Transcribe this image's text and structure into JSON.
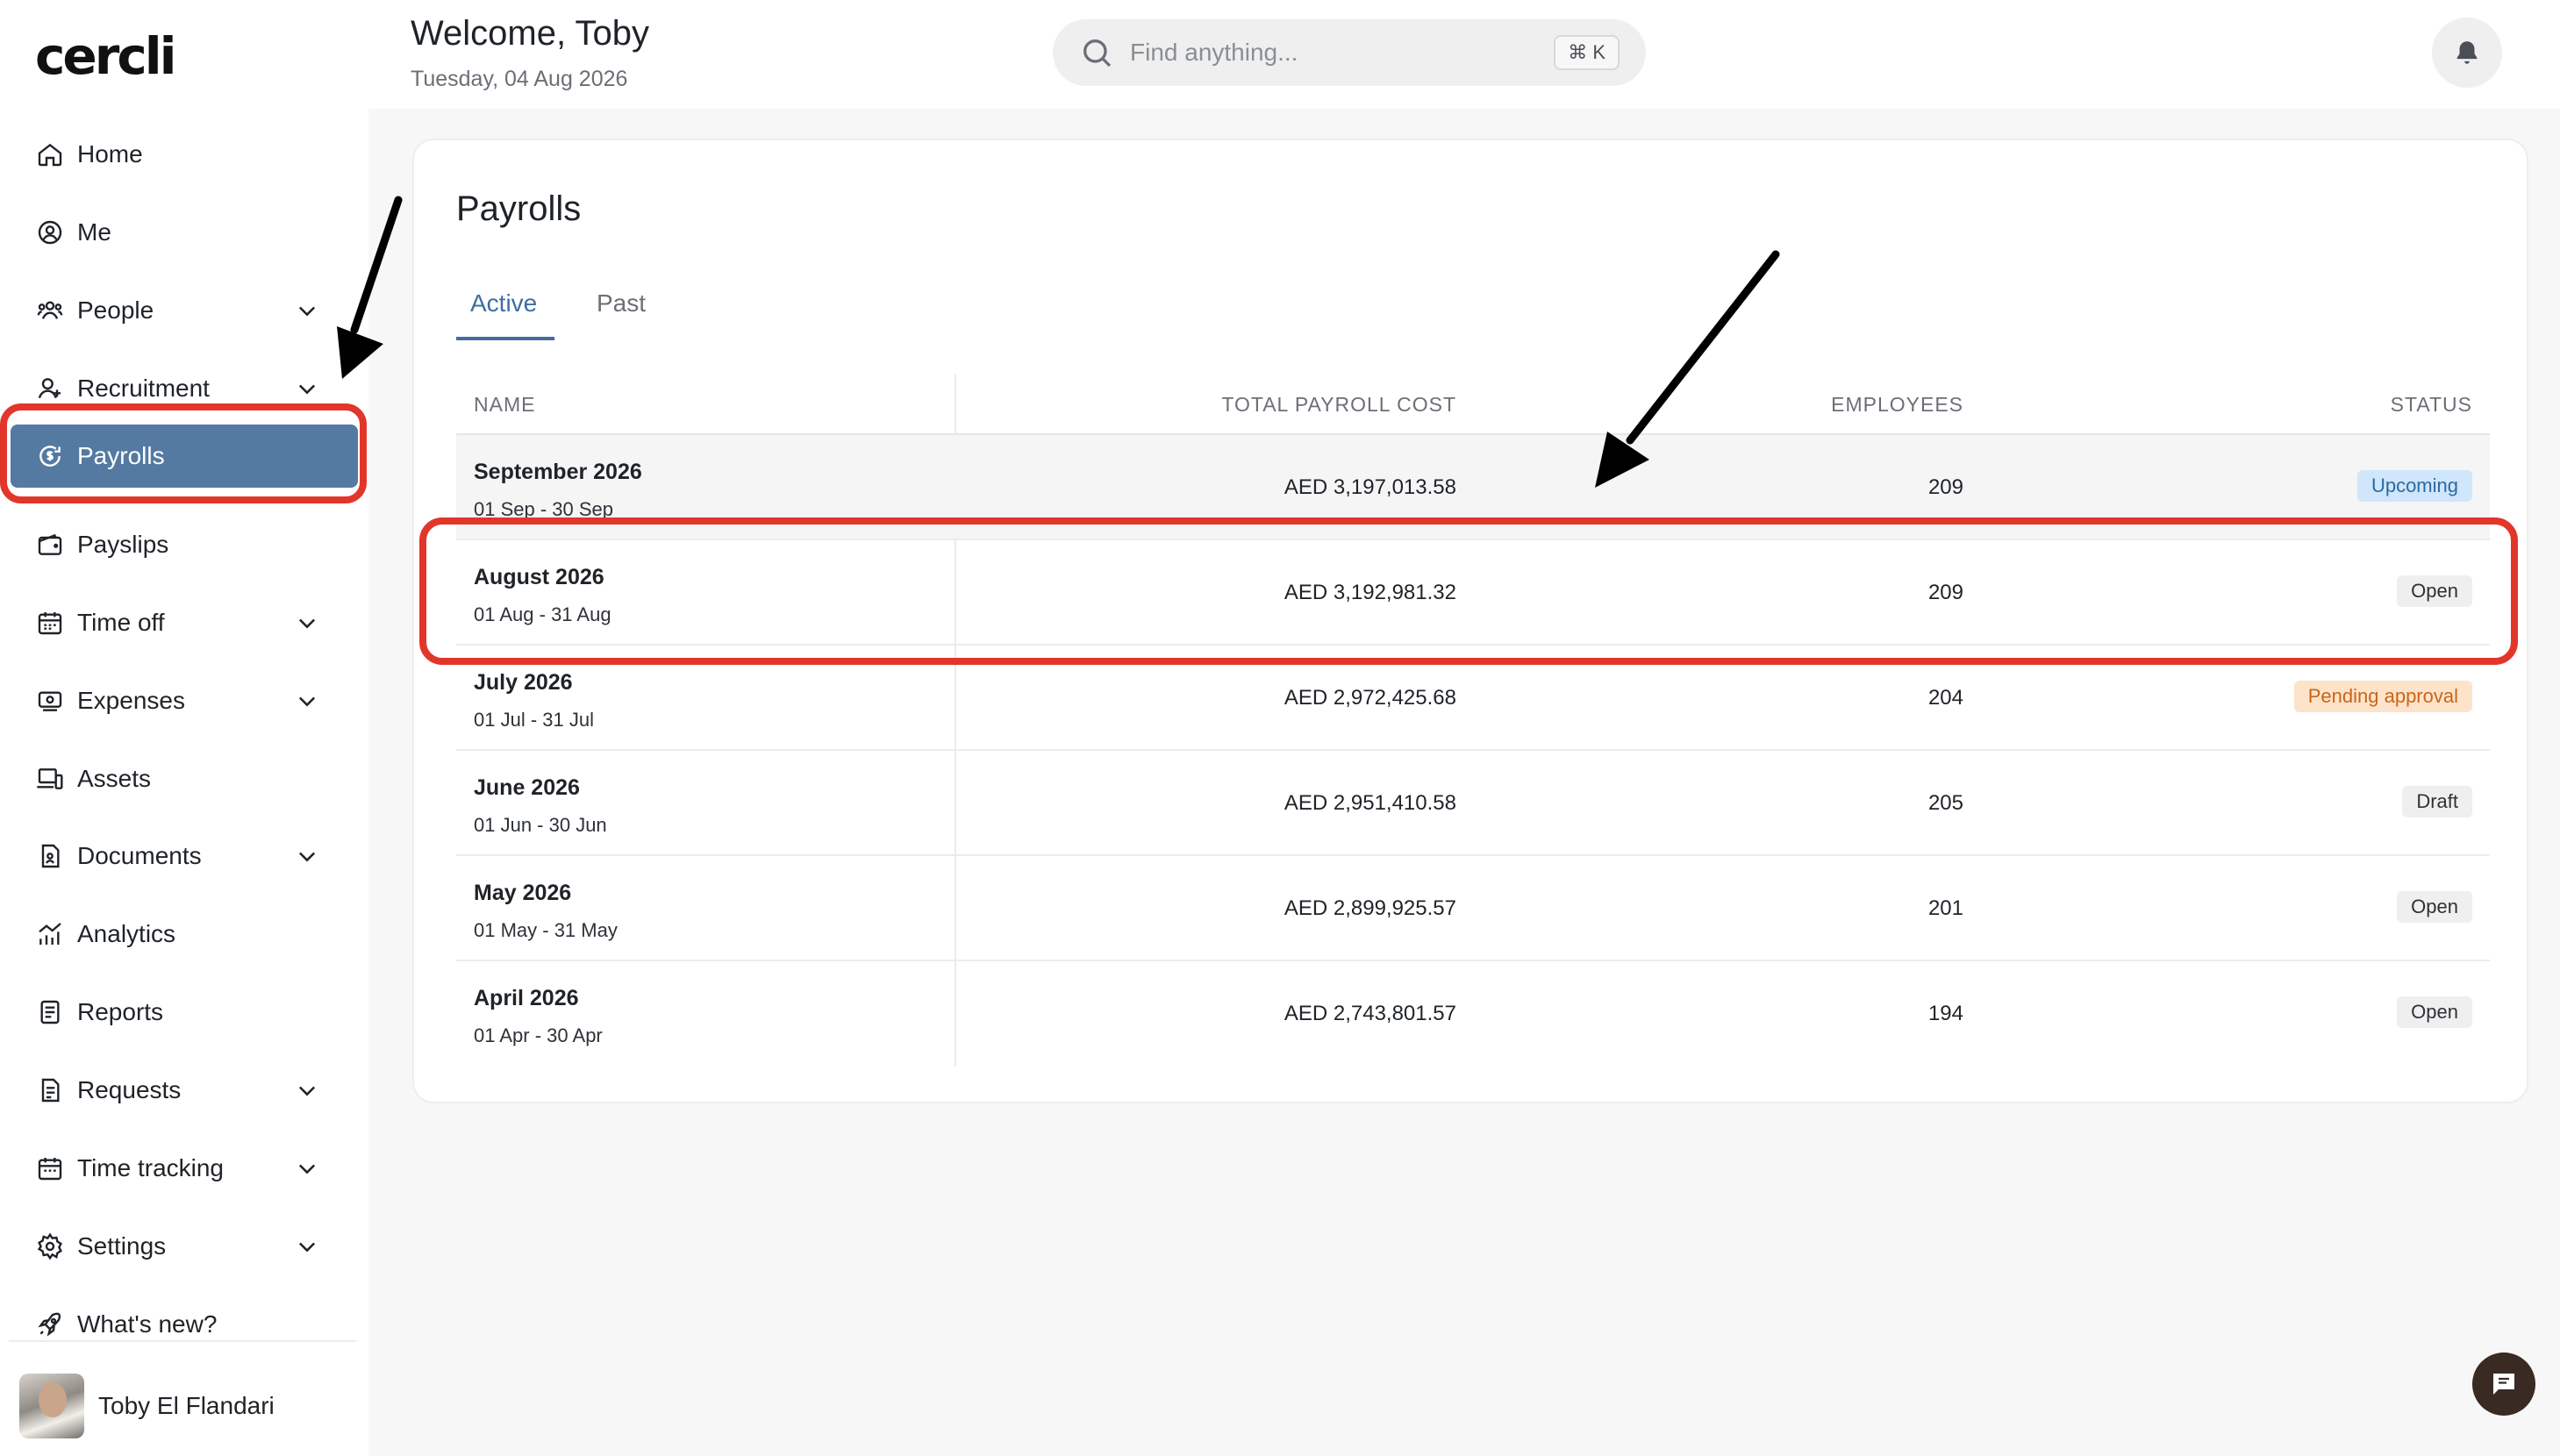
{
  "app": {
    "logo": "cercli"
  },
  "sidebar": {
    "items": [
      {
        "label": "Home",
        "icon": "home-icon",
        "expandable": false,
        "active": false
      },
      {
        "label": "Me",
        "icon": "user-circle-icon",
        "expandable": false,
        "active": false
      },
      {
        "label": "People",
        "icon": "people-icon",
        "expandable": true,
        "active": false
      },
      {
        "label": "Recruitment",
        "icon": "recruitment-icon",
        "expandable": true,
        "active": false
      },
      {
        "label": "Payrolls",
        "icon": "payroll-icon",
        "expandable": false,
        "active": true
      },
      {
        "label": "Payslips",
        "icon": "wallet-icon",
        "expandable": false,
        "active": false
      },
      {
        "label": "Time off",
        "icon": "calendar-icon",
        "expandable": true,
        "active": false
      },
      {
        "label": "Expenses",
        "icon": "receipt-icon",
        "expandable": true,
        "active": false
      },
      {
        "label": "Assets",
        "icon": "devices-icon",
        "expandable": false,
        "active": false
      },
      {
        "label": "Documents",
        "icon": "document-icon",
        "expandable": true,
        "active": false
      },
      {
        "label": "Analytics",
        "icon": "analytics-icon",
        "expandable": false,
        "active": false
      },
      {
        "label": "Reports",
        "icon": "report-icon",
        "expandable": false,
        "active": false
      },
      {
        "label": "Requests",
        "icon": "requests-icon",
        "expandable": true,
        "active": false
      },
      {
        "label": "Time tracking",
        "icon": "time-tracking-icon",
        "expandable": true,
        "active": false
      },
      {
        "label": "Settings",
        "icon": "gear-icon",
        "expandable": true,
        "active": false
      },
      {
        "label": "What's new?",
        "icon": "rocket-icon",
        "expandable": false,
        "active": false
      }
    ],
    "user": {
      "name": "Toby El Flandari"
    }
  },
  "header": {
    "welcome": "Welcome, Toby",
    "date": "Tuesday, 04 Aug 2026",
    "search_placeholder": "Find anything...",
    "search_shortcut": "⌘ K"
  },
  "page": {
    "title": "Payrolls",
    "tabs": [
      {
        "label": "Active",
        "active": true
      },
      {
        "label": "Past",
        "active": false
      }
    ],
    "columns": {
      "name": "NAME",
      "cost": "TOTAL PAYROLL COST",
      "employees": "EMPLOYEES",
      "status": "STATUS"
    },
    "rows": [
      {
        "name": "September 2026",
        "range": "01 Sep - 30 Sep",
        "cost": "AED 3,197,013.58",
        "employees": "209",
        "status": "Upcoming",
        "status_kind": "upcoming"
      },
      {
        "name": "August 2026",
        "range": "01 Aug - 31 Aug",
        "cost": "AED 3,192,981.32",
        "employees": "209",
        "status": "Open",
        "status_kind": "open"
      },
      {
        "name": "July 2026",
        "range": "01 Jul - 31 Jul",
        "cost": "AED 2,972,425.68",
        "employees": "204",
        "status": "Pending approval",
        "status_kind": "pending"
      },
      {
        "name": "June 2026",
        "range": "01 Jun - 30 Jun",
        "cost": "AED 2,951,410.58",
        "employees": "205",
        "status": "Draft",
        "status_kind": "draft"
      },
      {
        "name": "May 2026",
        "range": "01 May - 31 May",
        "cost": "AED 2,899,925.57",
        "employees": "201",
        "status": "Open",
        "status_kind": "open"
      },
      {
        "name": "April 2026",
        "range": "01 Apr - 30 Apr",
        "cost": "AED 2,743,801.57",
        "employees": "194",
        "status": "Open",
        "status_kind": "open"
      }
    ]
  },
  "colors": {
    "accent": "#3e6ea3",
    "active_nav": "#547aa2",
    "annotation_red": "#e2362a",
    "upcoming_badge": "#cfe6fb",
    "pending_badge": "#fde3c9"
  }
}
